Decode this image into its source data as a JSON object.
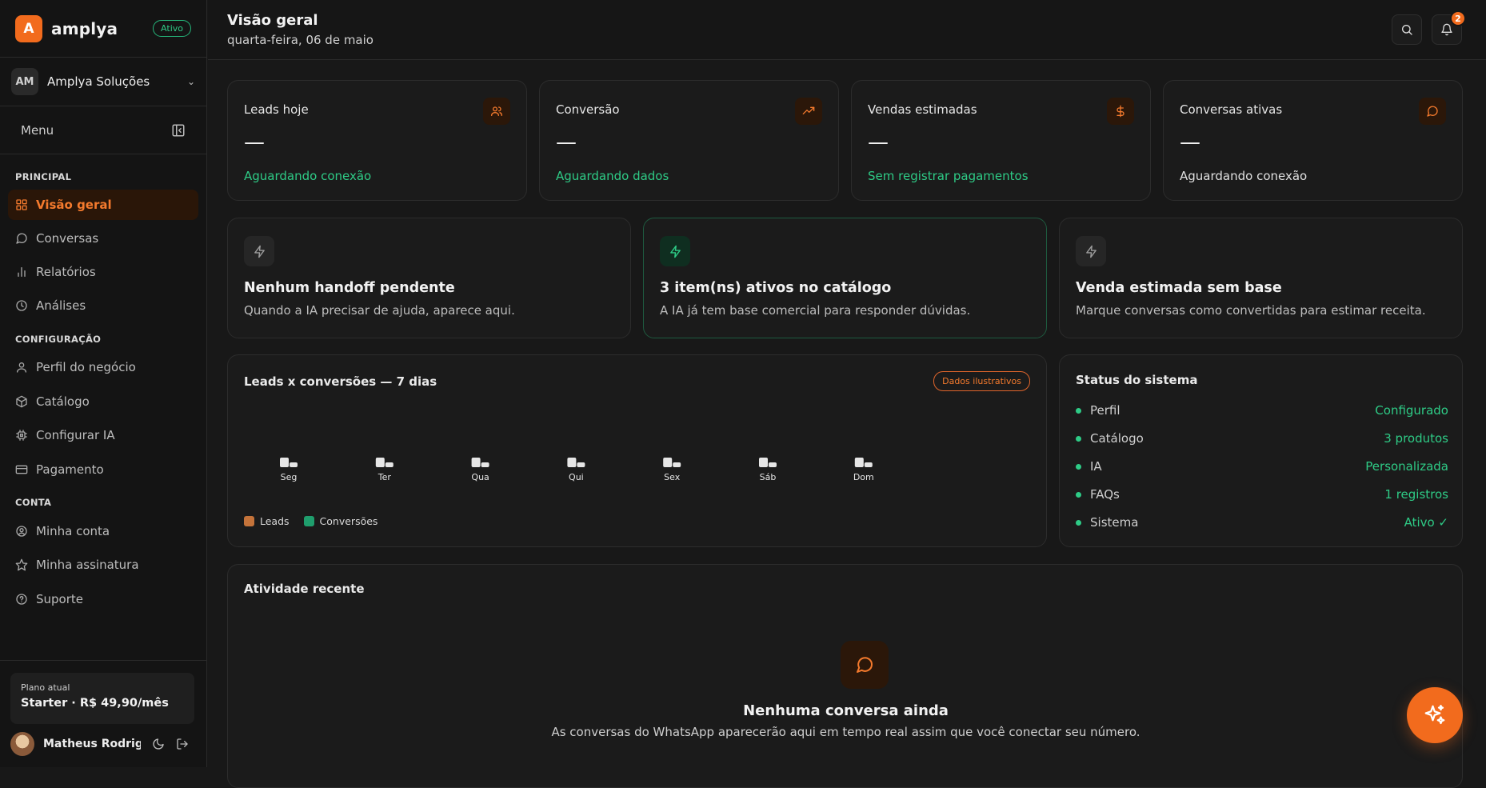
{
  "brand": {
    "logo_letter": "A",
    "name": "amplya",
    "status": "Ativo"
  },
  "company": {
    "initials": "AM",
    "name": "Amplya Soluções",
    "chevron": "⌄"
  },
  "menu": {
    "label": "Menu"
  },
  "sections": {
    "principal": "PRINCIPAL",
    "configuracao": "CONFIGURAÇÃO",
    "conta": "CONTA"
  },
  "nav": {
    "visao_geral": "Visão geral",
    "conversas": "Conversas",
    "relatorios": "Relatórios",
    "analises": "Análises",
    "perfil": "Perfil do negócio",
    "catalogo": "Catálogo",
    "configurar_ia": "Configurar IA",
    "pagamento": "Pagamento",
    "minha_conta": "Minha conta",
    "minha_assinatura": "Minha assinatura",
    "suporte": "Suporte"
  },
  "plan": {
    "label": "Plano atual",
    "value": "Starter · R$ 49,90/mês"
  },
  "user": {
    "name": "Matheus Rodrigu..."
  },
  "header": {
    "title": "Visão geral",
    "date": "quarta-feira, 06 de maio",
    "notifications": "2"
  },
  "kpis": [
    {
      "title": "Leads hoje",
      "value": "—",
      "sub": "Aguardando conexão",
      "icon": "users-icon"
    },
    {
      "title": "Conversão",
      "value": "—",
      "sub": "Aguardando dados",
      "icon": "trending-up-icon"
    },
    {
      "title": "Vendas estimadas",
      "value": "—",
      "sub": "Sem registrar pagamentos",
      "icon": "dollar-icon"
    },
    {
      "title": "Conversas ativas",
      "value": "—",
      "sub": "Aguardando conexão",
      "icon": "message-icon"
    }
  ],
  "features": [
    {
      "title": "Nenhum handoff pendente",
      "desc": "Quando a IA precisar de ajuda, aparece aqui."
    },
    {
      "title": "3 item(ns) ativos no catálogo",
      "desc": "A IA já tem base comercial para responder dúvidas."
    },
    {
      "title": "Venda estimada sem base",
      "desc": "Marque conversas como convertidas para estimar receita."
    }
  ],
  "chart_data": {
    "type": "bar",
    "title": "Leads x conversões — 7 dias",
    "badge": "Dados ilustrativos",
    "categories": [
      "Seg",
      "Ter",
      "Qua",
      "Qui",
      "Sex",
      "Sáb",
      "Dom"
    ],
    "series": [
      {
        "name": "Leads",
        "values": [
          0,
          0,
          0,
          0,
          0,
          0,
          0
        ]
      },
      {
        "name": "Conversões",
        "values": [
          0,
          0,
          0,
          0,
          0,
          0,
          0
        ]
      }
    ],
    "colors": {
      "leads_legend": "#c4733a",
      "conversions_legend": "#1f9e6d",
      "bar": "#e6e6e6"
    }
  },
  "status": {
    "title": "Status do sistema",
    "rows": [
      {
        "label": "Perfil",
        "value": "Configurado"
      },
      {
        "label": "Catálogo",
        "value": "3 produtos"
      },
      {
        "label": "IA",
        "value": "Personalizada"
      },
      {
        "label": "FAQs",
        "value": "1 registros"
      },
      {
        "label": "Sistema",
        "value": "Ativo ✓"
      }
    ]
  },
  "activity": {
    "title": "Atividade recente",
    "empty_title": "Nenhuma conversa ainda",
    "empty_desc": "As conversas do WhatsApp aparecerão aqui em tempo real assim que você conectar seu número."
  },
  "colors": {
    "accent": "#f26b1d",
    "success": "#2ecb86",
    "background": "#181818",
    "sidebar": "#141414"
  }
}
